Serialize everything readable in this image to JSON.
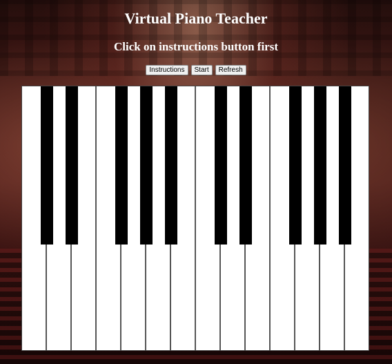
{
  "header": {
    "title": "Virtual Piano Teacher",
    "subtitle": "Click on instructions button first"
  },
  "controls": {
    "instructions_label": "Instructions",
    "start_label": "Start",
    "refresh_label": "Refresh"
  },
  "piano": {
    "white_key_count": 14,
    "black_key_count": 10,
    "colors": {
      "white_key": "#ffffff",
      "black_key": "#000000",
      "divider": "#555555"
    }
  }
}
